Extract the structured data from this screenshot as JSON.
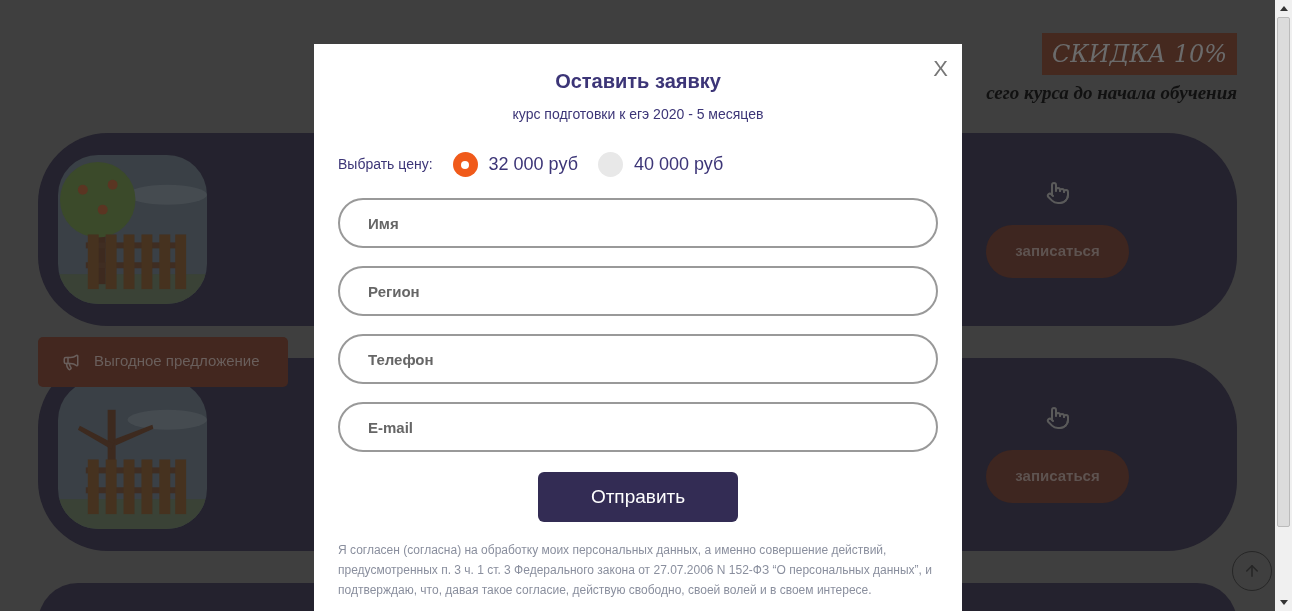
{
  "page": {
    "discount_badge": "СКИДКА 10%",
    "discount_note": "сего курса до начала обучения",
    "offers": [
      {
        "button": "записаться"
      },
      {
        "tag": "Выгодное предложение",
        "button": "записаться"
      }
    ]
  },
  "modal": {
    "close": "X",
    "title": "Оставить заявку",
    "subtitle": "курс подготовки к егэ 2020 - 5 месяцев",
    "price_label": "Выбрать цену:",
    "prices": [
      {
        "label": "32 000 руб",
        "selected": true
      },
      {
        "label": "40 000 руб",
        "selected": false
      }
    ],
    "fields": [
      {
        "placeholder": "Имя"
      },
      {
        "placeholder": "Регион"
      },
      {
        "placeholder": "Телефон"
      },
      {
        "placeholder": "E-mail"
      }
    ],
    "submit": "Отправить",
    "consent": "Я согласен (согласна) на обработку моих персональных данных, а именно совершение действий, предусмотренных п. 3 ч. 1 ст. 3 Федерального закона от 27.07.2006 N 152-ФЗ “О персональных данных”, и подтверждаю, что, давая такое согласие, действую свободно, своей волей и в своем интересе."
  }
}
